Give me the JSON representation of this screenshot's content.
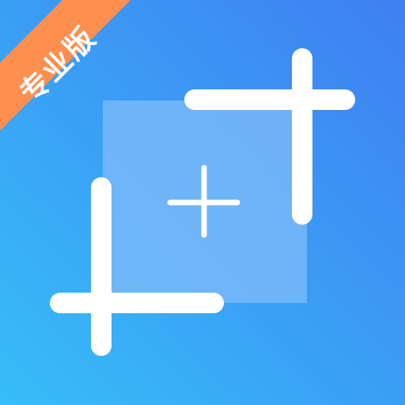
{
  "app_icon": {
    "badge_text": "专业版",
    "icon_name": "screenshot-crop-icon",
    "colors": {
      "gradient_start": "#37BDF8",
      "gradient_end": "#3F7FF2",
      "badge": "#FF8F4F",
      "crop_box": "#80BCF8",
      "marks": "#FFFFFF"
    }
  }
}
